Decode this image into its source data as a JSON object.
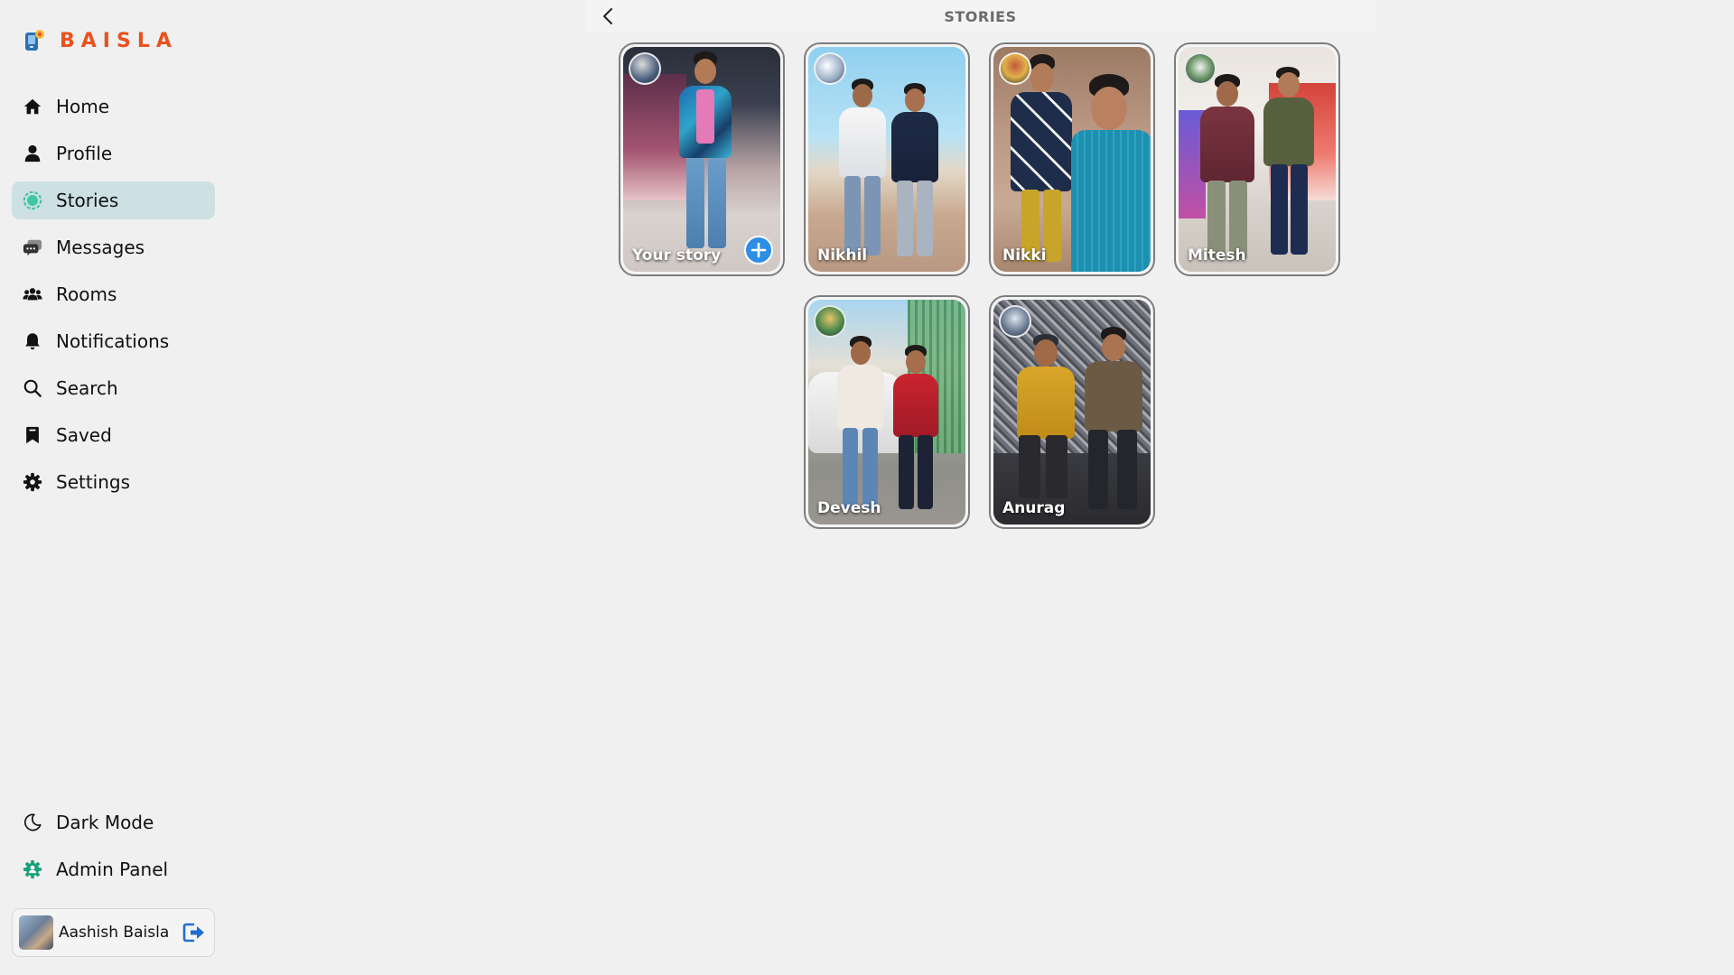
{
  "brand": {
    "name": "BAISLA",
    "color": "#e8521f",
    "logo_icon": "app-logo-icon"
  },
  "sidebar": {
    "items": [
      {
        "label": "Home",
        "icon": "home-icon",
        "active": false
      },
      {
        "label": "Profile",
        "icon": "user-icon",
        "active": false
      },
      {
        "label": "Stories",
        "icon": "stories-icon",
        "active": true
      },
      {
        "label": "Messages",
        "icon": "chat-icon",
        "active": false
      },
      {
        "label": "Rooms",
        "icon": "group-icon",
        "active": false
      },
      {
        "label": "Notifications",
        "icon": "bell-icon",
        "active": false
      },
      {
        "label": "Search",
        "icon": "search-icon",
        "active": false
      },
      {
        "label": "Saved",
        "icon": "bookmark-icon",
        "active": false
      },
      {
        "label": "Settings",
        "icon": "gear-icon",
        "active": false
      }
    ],
    "bottom_items": [
      {
        "label": "Dark Mode",
        "icon": "moon-icon"
      },
      {
        "label": "Admin Panel",
        "icon": "admin-icon"
      }
    ],
    "user": {
      "name": "Aashish Baisla",
      "logout_icon": "logout-icon"
    }
  },
  "header": {
    "title": "STORIES",
    "back_icon": "chevron-left-icon"
  },
  "stories": [
    {
      "name": "Your story",
      "own": true
    },
    {
      "name": "Nikhil",
      "own": false
    },
    {
      "name": "Nikki",
      "own": false
    },
    {
      "name": "Mitesh",
      "own": false
    },
    {
      "name": "Devesh",
      "own": false
    },
    {
      "name": "Anurag",
      "own": false
    }
  ],
  "colors": {
    "active_nav_bg": "#cde0e4",
    "add_button": "#2e8ee6",
    "page_bg": "#f0f0f0",
    "title_text": "#6b6b6b"
  }
}
